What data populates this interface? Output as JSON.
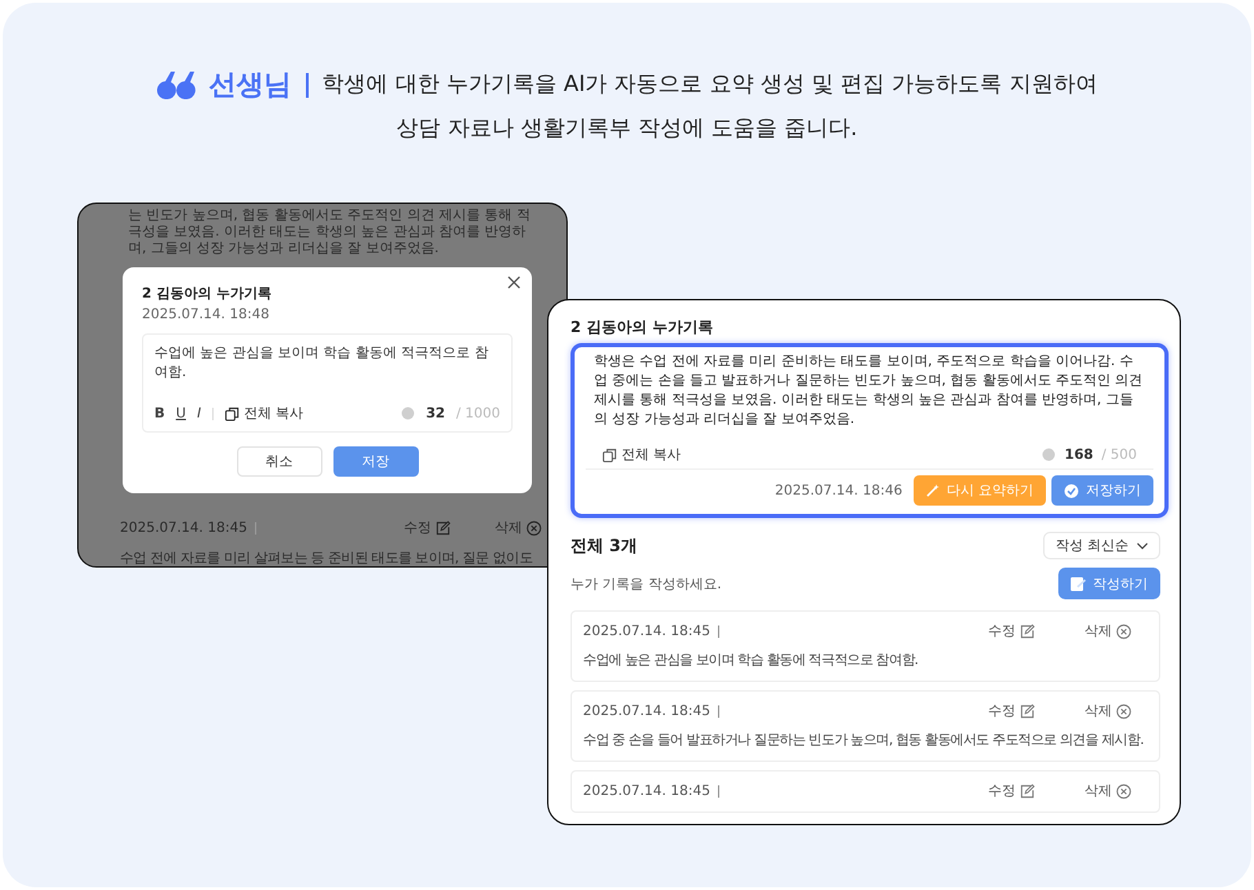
{
  "header": {
    "speaker": "선생님",
    "line_1": "학생에 대한 누가기록을 AI가 자동으로 요약 생성 및 편집 가능하도록 지원하여",
    "line_2": "상담 자료나 생활기록부 작성에 도움을 줍니다."
  },
  "background_screen": {
    "text": "는 빈도가 높으며, 협동 활동에서도 주도적인 의견 제시를 통해 적극성을 보였음. 이러한 태도는 학생의 높은 관심과 참여를 반영하며, 그들의 성장 가능성과 리더십을 잘 보여주었음.",
    "record": {
      "date": "2025.07.14. 18:45",
      "edit_label": "수정",
      "delete_label": "삭제",
      "text": "수업 전에 자료를 미리 살펴보는 등 준비된 태도를 보이며, 질문 없이도"
    }
  },
  "modal": {
    "title": "2 김동아의 누가기록",
    "date": "2025.07.14. 18:48",
    "content": "수업에 높은 관심을 보이며 학습 활동에 적극적으로 참여함.",
    "format_buttons": [
      {
        "label": "B",
        "kind": "bold"
      },
      {
        "label": "U",
        "kind": "underline"
      },
      {
        "label": "I",
        "kind": "italic"
      }
    ],
    "copy_label": "전체 복사",
    "count": "32",
    "limit": "/ 1000",
    "buttons": [
      {
        "label": "취소",
        "kind": "secondary"
      },
      {
        "label": "저장",
        "kind": "primary"
      }
    ]
  },
  "detail": {
    "title": "2 김동아의 누가기록",
    "summary": "학생은 수업 전에 자료를 미리 준비하는 태도를 보이며, 주도적으로 학습을 이어나감. 수업 중에는 손을 들고 발표하거나 질문하는 빈도가 높으며, 협동 활동에서도 주도적인 의견 제시를 통해 적극성을 보였음. 이러한 태도는 학생의 높은 관심과 참여를 반영하며, 그들의 성장 가능성과 리더십을 잘 보여주었음.",
    "copy_label": "전체 복사",
    "count": "168",
    "limit": "/ 500",
    "date": "2025.07.14. 18:46",
    "actions": [
      {
        "label": "다시 요약하기",
        "kind": "resummarize"
      },
      {
        "label": "저장하기",
        "kind": "save"
      }
    ],
    "total": "전체 3개",
    "sort": "작성 최신순",
    "hint": "누가 기록을 작성하세요.",
    "write_button": "작성하기",
    "records": [
      {
        "date": "2025.07.14. 18:45",
        "edit_label": "수정",
        "delete_label": "삭제",
        "text": "수업에 높은 관심을 보이며 학습 활동에 적극적으로 참여함."
      },
      {
        "date": "2025.07.14. 18:45",
        "edit_label": "수정",
        "delete_label": "삭제",
        "text": "수업 중 손을 들어 발표하거나 질문하는 빈도가 높으며, 협동 활동에서도 주도적으로 의견을 제시함."
      },
      {
        "date": "2025.07.14. 18:45",
        "edit_label": "수정",
        "delete_label": "삭제"
      }
    ]
  }
}
